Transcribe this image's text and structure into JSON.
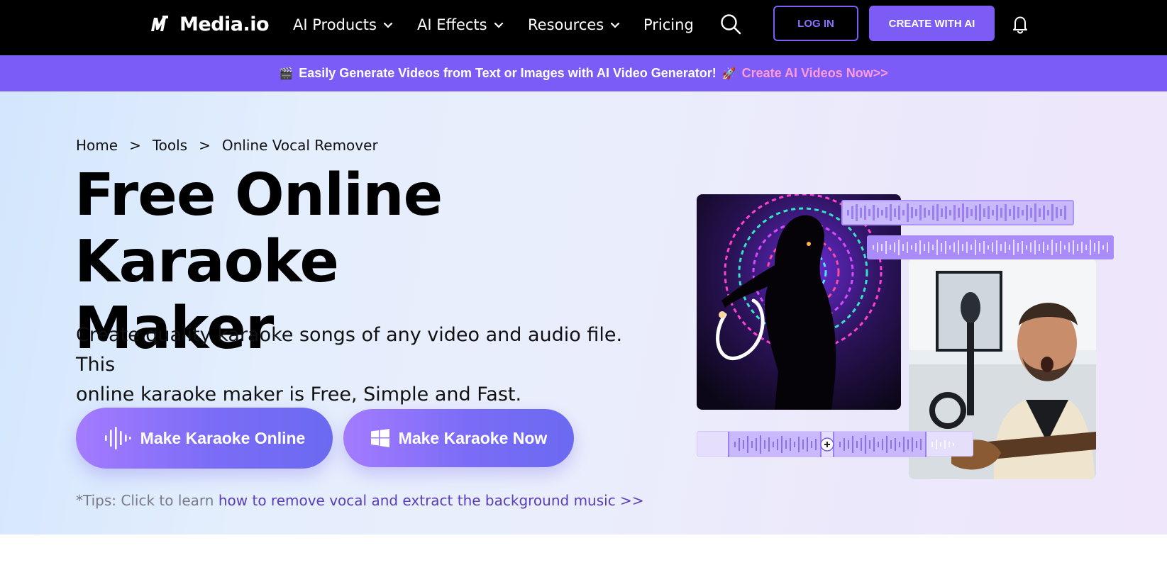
{
  "header": {
    "logo_text": "Media.io",
    "nav": [
      {
        "label": "AI Products",
        "has_dropdown": true
      },
      {
        "label": "AI Effects",
        "has_dropdown": true
      },
      {
        "label": "Resources",
        "has_dropdown": true
      },
      {
        "label": "Pricing",
        "has_dropdown": false
      }
    ],
    "login_label": "LOG IN",
    "create_label": "CREATE WITH AI",
    "icons": [
      "search-icon",
      "bell-icon"
    ]
  },
  "banner": {
    "emoji_left": "🎬",
    "text": "Easily Generate Videos from Text or Images with AI Video Generator!",
    "emoji_right": "🚀",
    "link": "Create AI Videos Now>>"
  },
  "breadcrumb": [
    {
      "label": "Home"
    },
    {
      "label": "Tools"
    },
    {
      "label": "Online Vocal Remover"
    }
  ],
  "breadcrumb_sep": ">",
  "hero": {
    "title_line1": "Free Online Karaoke",
    "title_line2": "Maker",
    "subtitle_line1": "Create quality karaoke songs of any video and audio file. This",
    "subtitle_line2": "online karaoke maker is Free, Simple and Fast.",
    "cta_online": "Make Karaoke Online",
    "cta_now": "Make Karaoke Now",
    "tips_prefix": "*Tips: Click to learn",
    "tips_link": "how to remove vocal and extract the background music >>"
  },
  "colors": {
    "accent": "#7c5cf5",
    "banner_bg": "#7c5cf6",
    "banner_link": "#ff9bd9",
    "tips_link": "#5a3db8"
  }
}
